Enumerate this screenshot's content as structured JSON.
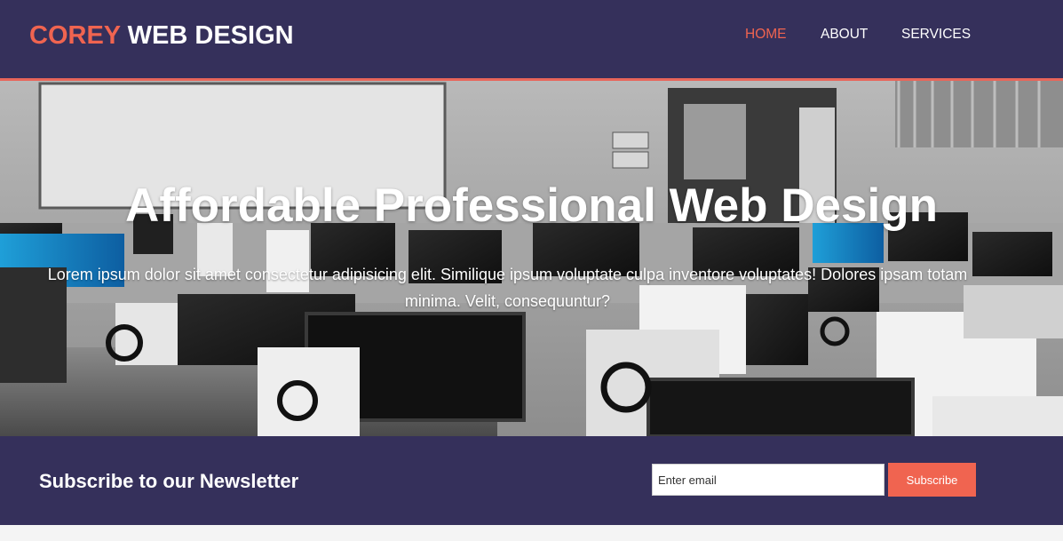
{
  "branding": {
    "logo_highlight": "COREY",
    "logo_rest": " WEB DESIGN"
  },
  "nav": {
    "items": [
      {
        "label": "HOME",
        "active": true
      },
      {
        "label": "ABOUT",
        "active": false
      },
      {
        "label": "SERVICES",
        "active": false
      }
    ]
  },
  "showcase": {
    "title": "Affordable Professional Web Design",
    "text": "Lorem ipsum dolor sit amet consectetur adipisicing elit. Similique ipsum voluptate culpa inventore voluptates! Dolores ipsam totam minima. Velit, consequuntur?"
  },
  "newsletter": {
    "heading": "Subscribe to our Newsletter",
    "email_placeholder": "Enter email",
    "button_label": "Subscribe"
  },
  "colors": {
    "header_bg": "#35305b",
    "accent": "#f06450",
    "text": "#ffffff"
  }
}
